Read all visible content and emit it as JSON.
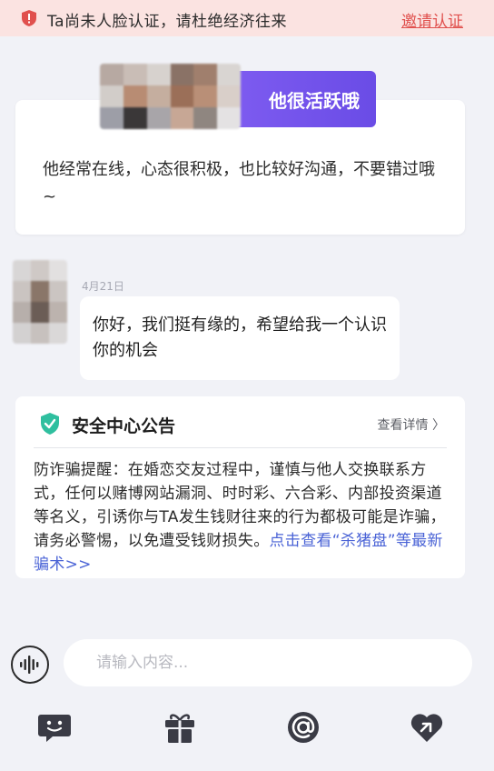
{
  "banner": {
    "text": "Ta尚未人脸认证，请杜绝经济往来",
    "invite_label": "邀请认证",
    "colors": {
      "background": "#fbe3e1",
      "accent": "#e0504d"
    }
  },
  "profile_card": {
    "tag": "他很活跃哦",
    "description": "他经常在线，心态很积极，也比较好沟通，不要错过哦~",
    "tag_color": "#7d5bf0"
  },
  "message": {
    "date": "4月21日",
    "text": "你好，我们挺有缘的，希望给我一个认识你的机会"
  },
  "notice": {
    "title": "安全中心公告",
    "detail_label": "查看详情 〉",
    "body": "防诈骗提醒：在婚恋交友过程中，谨慎与他人交换联系方式，任何以赌博网站漏洞、时时彩、六合彩、内部投资渠道等名义，引诱你与TA发生钱财往来的行为都极可能是诈骗，请务必警惕，以免遭受钱财损失。",
    "link_text": "点击查看“杀猪盘”等最新骗术>>",
    "shield_color": "#2fbf9f",
    "link_color": "#4a63d6"
  },
  "composer": {
    "placeholder": "请输入内容..."
  },
  "toolbar": {
    "icons": [
      "chat-face-icon",
      "gift-icon",
      "at-icon",
      "heart-link-icon"
    ]
  }
}
